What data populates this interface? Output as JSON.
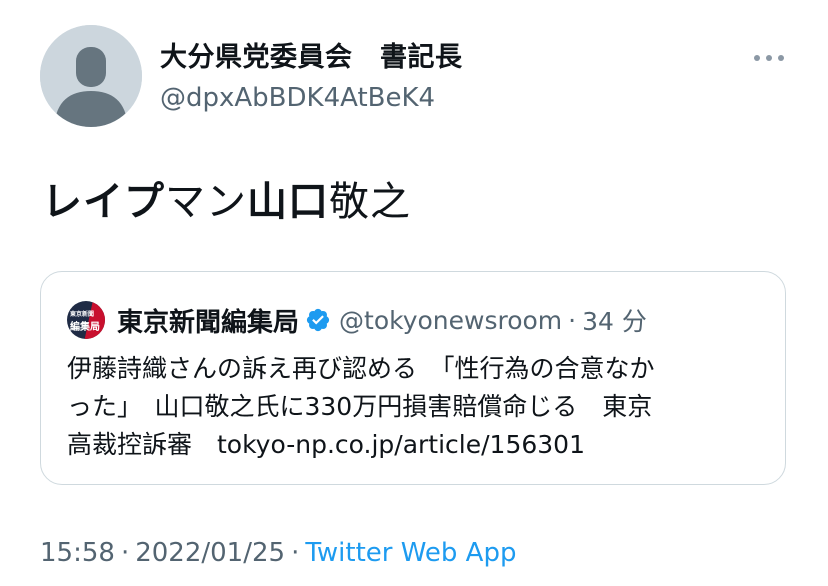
{
  "author": {
    "display_name": "大分県党委員会　書記長",
    "handle": "@dpxAbBDK4AtBeK4"
  },
  "tweet": {
    "text_parts": {
      "p1": "レイプ",
      "p2": "マン",
      "p3": "山口",
      "p4": "敬之"
    }
  },
  "quoted_tweet": {
    "avatar_text_top": "東京新聞",
    "avatar_text_bottom": "編集局",
    "display_name": "東京新聞編集局",
    "handle": "@tokyonewsroom",
    "separator": "·",
    "time": "34 分",
    "lines": [
      "伊藤詩織さんの訴え再び認める　「性行為の合意なか",
      "った」　山口敬之氏に330万円損害賠償命じる　東京",
      "高裁控訴審　tokyo-np.co.jp/article/156301"
    ]
  },
  "meta": {
    "time": "15:58",
    "separator": "·",
    "date": "2022/01/25",
    "source": "Twitter Web App"
  },
  "colors": {
    "text": "#0f1419",
    "secondary": "#536471",
    "link": "#1d9bf0",
    "border": "#cfd9de",
    "verified": "#1d9bf0"
  },
  "icons": {
    "more": "more-horizontal-icon",
    "verified": "verified-badge-icon",
    "avatar": "default-avatar-icon"
  }
}
